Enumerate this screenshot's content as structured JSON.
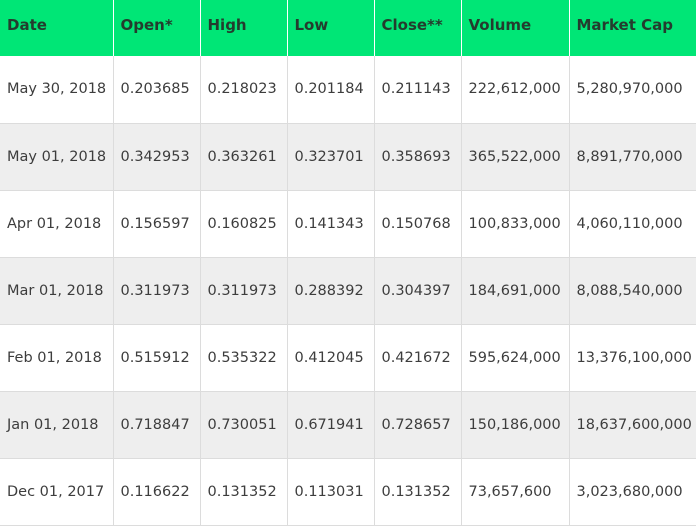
{
  "table": {
    "columns": [
      "Date",
      "Open*",
      "High",
      "Low",
      "Close**",
      "Volume",
      "Market Cap"
    ],
    "rows": [
      [
        "May 30, 2018",
        "0.203685",
        "0.218023",
        "0.201184",
        "0.211143",
        "222,612,000",
        "5,280,970,000"
      ],
      [
        "May 01, 2018",
        "0.342953",
        "0.363261",
        "0.323701",
        "0.358693",
        "365,522,000",
        "8,891,770,000"
      ],
      [
        "Apr 01, 2018",
        "0.156597",
        "0.160825",
        "0.141343",
        "0.150768",
        "100,833,000",
        "4,060,110,000"
      ],
      [
        "Mar 01, 2018",
        "0.311973",
        "0.311973",
        "0.288392",
        "0.304397",
        "184,691,000",
        "8,088,540,000"
      ],
      [
        "Feb 01, 2018",
        "0.515912",
        "0.535322",
        "0.412045",
        "0.421672",
        "595,624,000",
        "13,376,100,000"
      ],
      [
        "Jan 01, 2018",
        "0.718847",
        "0.730051",
        "0.671941",
        "0.728657",
        "150,186,000",
        "18,637,600,000"
      ],
      [
        "Dec 01, 2017",
        "0.116622",
        "0.131352",
        "0.113031",
        "0.131352",
        "73,657,600",
        "3,023,680,000"
      ]
    ]
  },
  "colors": {
    "header_background": "#00e676",
    "header_text": "#243c2e",
    "row_alt_background": "#eeeeee",
    "cell_text": "#3d3d3d"
  }
}
